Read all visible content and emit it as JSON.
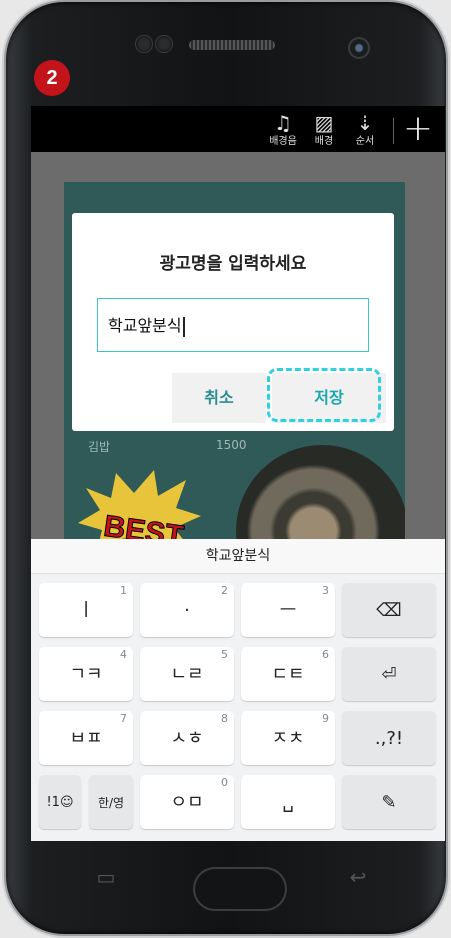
{
  "step_badge": "2",
  "toolbar": {
    "bgm_icon": "♫",
    "bgm_label": "배경음",
    "background_icon": "▨",
    "background_label": "배경",
    "order_icon": "⇣",
    "order_label": "순서",
    "add_icon": "+"
  },
  "poster": {
    "item_name": "김밥",
    "item_price": "1500",
    "badge_text": "BEST"
  },
  "dialog": {
    "title": "광고명을 입력하세요",
    "input_value": "학교앞분식",
    "cancel_label": "취소",
    "save_label": "저장"
  },
  "keyboard": {
    "suggestion": "학교앞분식",
    "rows": [
      [
        {
          "label": "ㅣ",
          "num": "1"
        },
        {
          "label": "·",
          "num": "2"
        },
        {
          "label": "ㅡ",
          "num": "3"
        },
        {
          "label": "⌫",
          "num": ""
        }
      ],
      [
        {
          "label": "ㄱㅋ",
          "num": "4"
        },
        {
          "label": "ㄴㄹ",
          "num": "5"
        },
        {
          "label": "ㄷㅌ",
          "num": "6"
        },
        {
          "label": "⏎",
          "num": ""
        }
      ],
      [
        {
          "label": "ㅂㅍ",
          "num": "7"
        },
        {
          "label": "ㅅㅎ",
          "num": "8"
        },
        {
          "label": "ㅈㅊ",
          "num": "9"
        },
        {
          "label": ".,?!",
          "num": ""
        }
      ],
      [
        {
          "label": "!1☺",
          "num": ""
        },
        {
          "label": "한/영",
          "num": ""
        },
        {
          "label": "ㅇㅁ",
          "num": "0"
        },
        {
          "label": "␣",
          "num": ""
        },
        {
          "label": "✎",
          "num": ""
        }
      ]
    ]
  },
  "nav": {
    "recent_icon": "▭",
    "back_icon": "↩"
  },
  "colors": {
    "accent": "#1aa8b0",
    "badge": "#c4141b",
    "highlight": "#2fd0e0"
  }
}
